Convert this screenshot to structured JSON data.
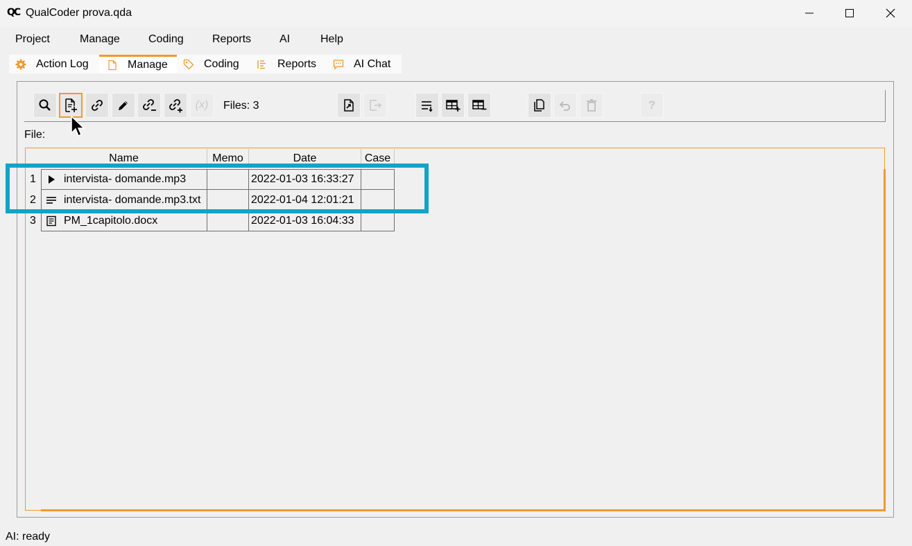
{
  "window": {
    "logo": "QC",
    "title": "QualCoder prova.qda"
  },
  "menu": [
    "Project",
    "Manage",
    "Coding",
    "Reports",
    "AI",
    "Help"
  ],
  "tabs": [
    {
      "label": "Action Log",
      "icon": "gear-icon",
      "active": false
    },
    {
      "label": "Manage",
      "icon": "file-icon",
      "active": true
    },
    {
      "label": "Coding",
      "icon": "tag-icon",
      "active": false
    },
    {
      "label": "Reports",
      "icon": "list-icon",
      "active": false
    },
    {
      "label": "AI Chat",
      "icon": "chat-icon",
      "active": false
    }
  ],
  "toolbar": {
    "files_count": "Files: 3",
    "variable_button": "(x)",
    "help_button": "?"
  },
  "file_label": "File:",
  "table": {
    "columns": [
      "Name",
      "Memo",
      "Date",
      "Case"
    ],
    "rows": [
      {
        "num": "1",
        "icon": "play-icon",
        "name": "intervista- domande.mp3",
        "memo": "",
        "date": "2022-01-03 16:33:27",
        "case": ""
      },
      {
        "num": "2",
        "icon": "text-lines-icon",
        "name": "intervista- domande.mp3.txt",
        "memo": "",
        "date": "2022-01-04 12:01:21",
        "case": ""
      },
      {
        "num": "3",
        "icon": "document-icon",
        "name": "PM_1capitolo.docx",
        "memo": "",
        "date": "2022-01-03 16:04:33",
        "case": ""
      }
    ]
  },
  "status": "AI: ready",
  "colors": {
    "accent": "#f09a2c",
    "highlight": "#10a5c7"
  }
}
